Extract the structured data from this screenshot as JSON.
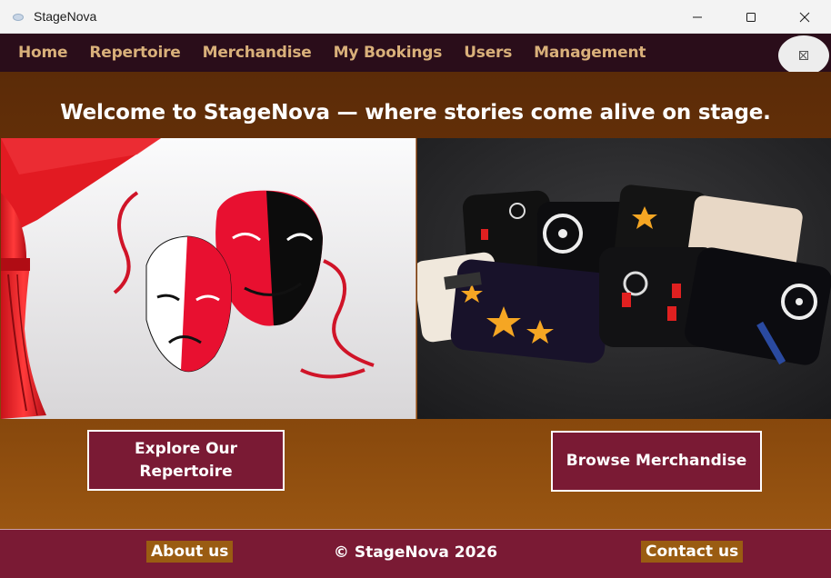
{
  "window": {
    "title": "StageNova"
  },
  "nav": {
    "items": [
      {
        "label": "Home"
      },
      {
        "label": "Repertoire"
      },
      {
        "label": "Merchandise"
      },
      {
        "label": "My Bookings"
      },
      {
        "label": "Users"
      },
      {
        "label": "Management"
      }
    ]
  },
  "main": {
    "welcome": "Welcome to StageNova — where stories come alive on stage.",
    "explore_button": "Explore Our Repertoire",
    "browse_button": "Browse Merchandise"
  },
  "footer": {
    "about": "About us",
    "copyright": "© StageNova 2026",
    "contact": "Contact us"
  },
  "colors": {
    "nav_bg": "#2a0d1a",
    "nav_text": "#d9b07a",
    "accent": "#7a1a34",
    "brown": "#6e3508",
    "footer_link_bg": "#9a5c12"
  }
}
